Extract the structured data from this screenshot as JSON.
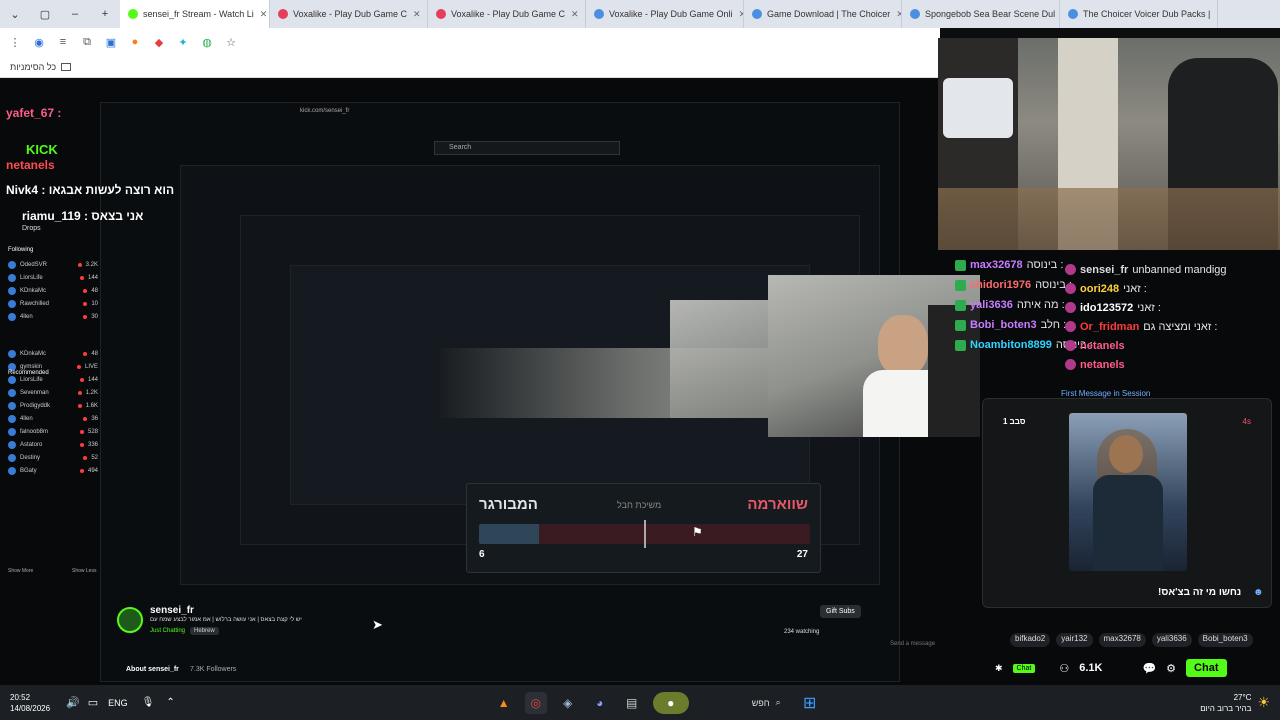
{
  "tabs": [
    {
      "label": "sensei_fr Stream - Watch Li",
      "color": "#53fc18",
      "active": true
    },
    {
      "label": "Voxalike - Play Dub Game C",
      "color": "#e53e5a"
    },
    {
      "label": "Voxalike - Play Dub Game C",
      "color": "#e53e5a"
    },
    {
      "label": "Voxalike - Play Dub Game Onli",
      "color": "#4a8fe0"
    },
    {
      "label": "Game Download | The Choicer",
      "color": "#4a8fe0"
    },
    {
      "label": "Spongebob Sea Bear Scene Dul",
      "color": "#4a8fe0"
    },
    {
      "label": "The Choicer Voicer Dub Packs |",
      "color": "#4a8fe0"
    }
  ],
  "bookmarks": {
    "label": "כל הסימניות"
  },
  "overlay_chat": [
    {
      "user": "yafet_67 :",
      "text": "",
      "color": "#ff5c8a"
    },
    {
      "user": "netanels",
      "text": "",
      "color": "#ff4d4d"
    },
    {
      "user": "Nivk4 :",
      "text": "הוא רוצה לעשות אבגאו",
      "color": "#ffffff"
    },
    {
      "user": "riamu_119 :",
      "text": "אני בצאס",
      "color": "#ffffff"
    }
  ],
  "overlay_misc": {
    "following": "Following",
    "drops": "Drops",
    "recommended": "Recommended",
    "show_more": "Show More",
    "show_less": "Show Less",
    "search": "Search",
    "url": "kick.com/sensei_fr"
  },
  "sidebar_channels": [
    {
      "name": "OdedSVR",
      "count": "3.2K"
    },
    {
      "name": "LiorsLife",
      "count": "144"
    },
    {
      "name": "KDnkaMc",
      "count": "48"
    },
    {
      "name": "Rawchilled",
      "count": "10"
    },
    {
      "name": "4llen",
      "count": "30"
    },
    {
      "name": "KDnkaMc",
      "count": "48"
    },
    {
      "name": "gymskin",
      "count": "LIVE"
    },
    {
      "name": "LiorsLife",
      "count": "144"
    },
    {
      "name": "Sevenman",
      "count": "1.2K"
    },
    {
      "name": "Prodigyddk",
      "count": "1.6K"
    },
    {
      "name": "4llen",
      "count": "36"
    },
    {
      "name": "falnoob8m",
      "count": "528"
    },
    {
      "name": "Astatoro",
      "count": "336"
    },
    {
      "name": "Destiny",
      "count": "52"
    },
    {
      "name": "BGaty",
      "count": "494"
    }
  ],
  "streamer": {
    "name": "sensei_fr",
    "subtitle": "יש לי קצת בצאס | אני עושה ברלוש | אמ אמור לבצע שמח עם",
    "category": "Just Chatting",
    "tag": "Hebrew",
    "about": "About sensei_fr",
    "followers": "7.3K Followers",
    "watching": "234 watching",
    "gift": "Gift Subs"
  },
  "vote": {
    "left_title": "המבורגר",
    "right_title": "שווארמה",
    "mid_label": "משיכת חבל",
    "left_score": "6",
    "right_score": "27",
    "left_share": 0.18
  },
  "right_chat": [
    {
      "user": "max32678",
      "text": "בינוסה :",
      "color": "#c77dff"
    },
    {
      "user": "chidori1976",
      "text": "בינוסה :",
      "color": "#ff6b6b"
    },
    {
      "user": "yali3636",
      "text": "מה איתה :",
      "color": "#c77dff"
    },
    {
      "user": "Bobi_boten3",
      "text": "חלב :",
      "color": "#c77dff"
    },
    {
      "user": "Noambiton8899",
      "text": "בינוסה :",
      "color": "#30d5ff"
    }
  ],
  "right_chat2": [
    {
      "user": "sensei_fr",
      "text": "unbanned mandigg",
      "color": "#dddddd"
    },
    {
      "user": "oori248",
      "text": "זאני :",
      "color": "#ffd23a"
    },
    {
      "user": "ido123572",
      "text": "זאני :",
      "color": "#ffffff"
    },
    {
      "user": "Or_fridman",
      "text": "זאני ומציצה גם :",
      "color": "#ff3b3b"
    },
    {
      "user": "netanels",
      "text": "",
      "color": "#ff5c8a"
    },
    {
      "user": "netanels",
      "text": "",
      "color": "#ff5c8a"
    }
  ],
  "first_message": "First Message in Session",
  "dub": {
    "round": "סבב 1",
    "timer": "4s",
    "question": "נחשו מי זה בצ'אס!",
    "players": [
      "bifkado2",
      "yair132",
      "max32678",
      "yali3636",
      "Bobi_boten3"
    ]
  },
  "stream_bar": {
    "chat_btn": "Chat",
    "viewers": "6.1K",
    "chat_label": "Chat"
  },
  "chat_input": {
    "placeholder": "Send a message"
  },
  "taskbar": {
    "time": "20:52",
    "date": "14/08/2026",
    "lang": "ENG",
    "search": "חפש",
    "weather_temp": "27°C",
    "weather_desc": "בהיר ברוב היום"
  }
}
